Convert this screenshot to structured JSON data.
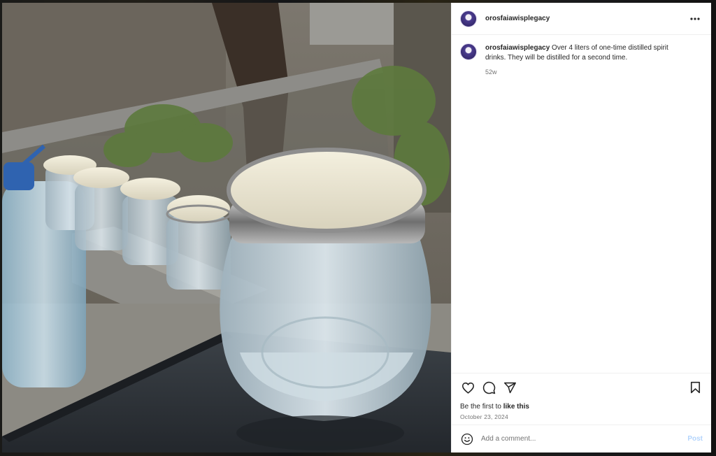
{
  "post": {
    "username": "orosfaiawisplegacy",
    "caption_user": "orosfaiawisplegacy",
    "caption_text": " Over 4 liters of one-time distilled spirit drinks. They will be distilled for a second time.",
    "caption_age": "52w",
    "likes_prefix": "Be the first to ",
    "likes_link": "like this",
    "date": "October 23, 2024"
  },
  "comment": {
    "placeholder": "Add a comment...",
    "post_label": "Post"
  },
  "icons": {
    "more": "more-horizontal-icon",
    "like": "heart-icon",
    "comment": "comment-bubble-icon",
    "share": "paper-plane-icon",
    "save": "bookmark-icon",
    "emoji": "smiley-icon"
  },
  "colors": {
    "post_button_disabled": "#b3d4fc",
    "secondary_text": "#737373"
  }
}
